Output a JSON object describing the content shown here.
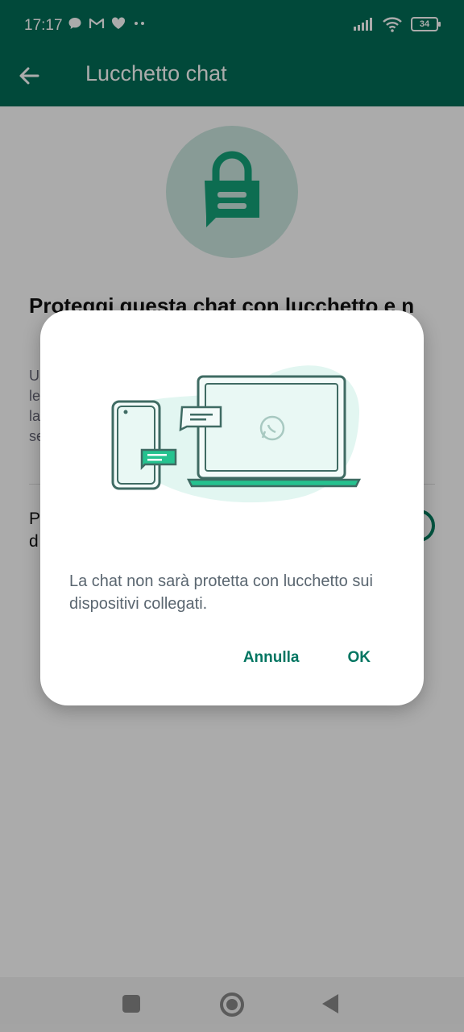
{
  "status": {
    "time": "17:17",
    "battery": "34",
    "left_icons": [
      "chat-bubble-icon",
      "gmail-icon",
      "heart-icon",
      "more-dots-icon"
    ],
    "right_icons": [
      "signal-icon",
      "wifi-icon",
      "battery-icon"
    ]
  },
  "app_bar": {
    "title": "Lucchetto chat"
  },
  "main": {
    "heading": "Proteggi questa chat con lucchetto e n",
    "description": "U\nle\nla\nse",
    "setting_label": "P\nd"
  },
  "dialog": {
    "message": "La chat non sarà protetta con lucchetto sui dispositivi collegati.",
    "cancel_label": "Annulla",
    "ok_label": "OK"
  },
  "colors": {
    "primary": "#026e57",
    "accent": "#017561",
    "illustration_green": "#25c28f",
    "scrim": "rgba(0,0,0,0.33)"
  }
}
